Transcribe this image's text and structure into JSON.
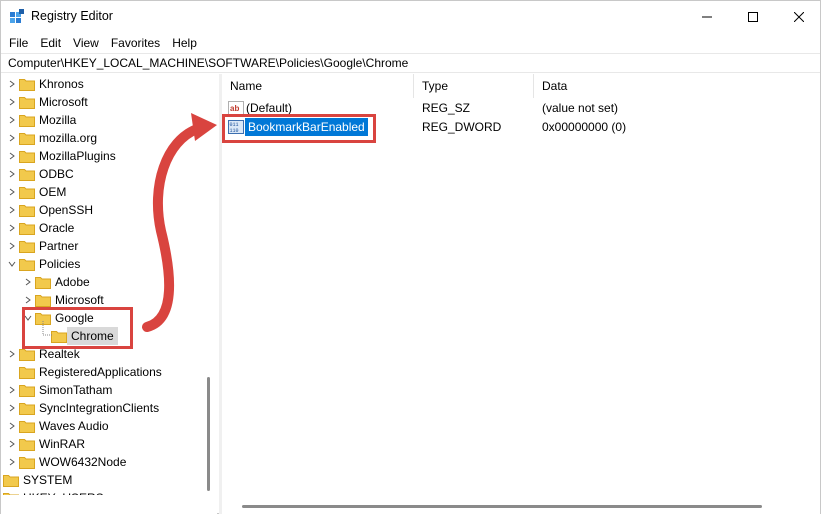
{
  "window": {
    "title": "Registry Editor",
    "icon": "registry-editor-icon"
  },
  "title_controls": {
    "minimize": "minimize-icon",
    "maximize": "maximize-icon",
    "close": "close-icon"
  },
  "menu": {
    "items": [
      "File",
      "Edit",
      "View",
      "Favorites",
      "Help"
    ]
  },
  "address": {
    "path": "Computer\\HKEY_LOCAL_MACHINE\\SOFTWARE\\Policies\\Google\\Chrome"
  },
  "tree": {
    "items": [
      {
        "label": "Khronos",
        "expanded": false
      },
      {
        "label": "Microsoft",
        "expanded": false
      },
      {
        "label": "Mozilla",
        "expanded": false
      },
      {
        "label": "mozilla.org",
        "expanded": false
      },
      {
        "label": "MozillaPlugins",
        "expanded": false
      },
      {
        "label": "ODBC",
        "expanded": false
      },
      {
        "label": "OEM",
        "expanded": false
      },
      {
        "label": "OpenSSH",
        "expanded": false
      },
      {
        "label": "Oracle",
        "expanded": false
      },
      {
        "label": "Partner",
        "expanded": false
      },
      {
        "label": "Policies",
        "expanded": true
      },
      {
        "label": "Adobe",
        "expanded": false
      },
      {
        "label": "Microsoft",
        "expanded": false
      },
      {
        "label": "Google",
        "expanded": true
      },
      {
        "label": "Chrome",
        "selected": true
      },
      {
        "label": "Realtek",
        "expanded": false
      },
      {
        "label": "RegisteredApplications"
      },
      {
        "label": "SimonTatham",
        "expanded": false
      },
      {
        "label": "SyncIntegrationClients",
        "expanded": false
      },
      {
        "label": "Waves Audio",
        "expanded": false
      },
      {
        "label": "WinRAR",
        "expanded": false
      },
      {
        "label": "WOW6432Node",
        "expanded": false
      },
      {
        "label": "SYSTEM",
        "expanded": false
      },
      {
        "label": "HKEY_USERS",
        "expanded": false
      }
    ]
  },
  "list": {
    "columns": [
      "Name",
      "Type",
      "Data"
    ],
    "rows": [
      {
        "name": "(Default)",
        "type": "REG_SZ",
        "data": "(value not set)",
        "icon": "string-value-icon"
      },
      {
        "name": "BookmarkBarEnabled",
        "type": "REG_DWORD",
        "data": "0x00000000 (0)",
        "icon": "binary-value-icon",
        "selected": true
      }
    ]
  },
  "annotation": {
    "color": "#d9443f"
  },
  "colors": {
    "selection": "#0078d7",
    "folder": "#f2c94c",
    "tree_selected": "#d9d9d9"
  }
}
